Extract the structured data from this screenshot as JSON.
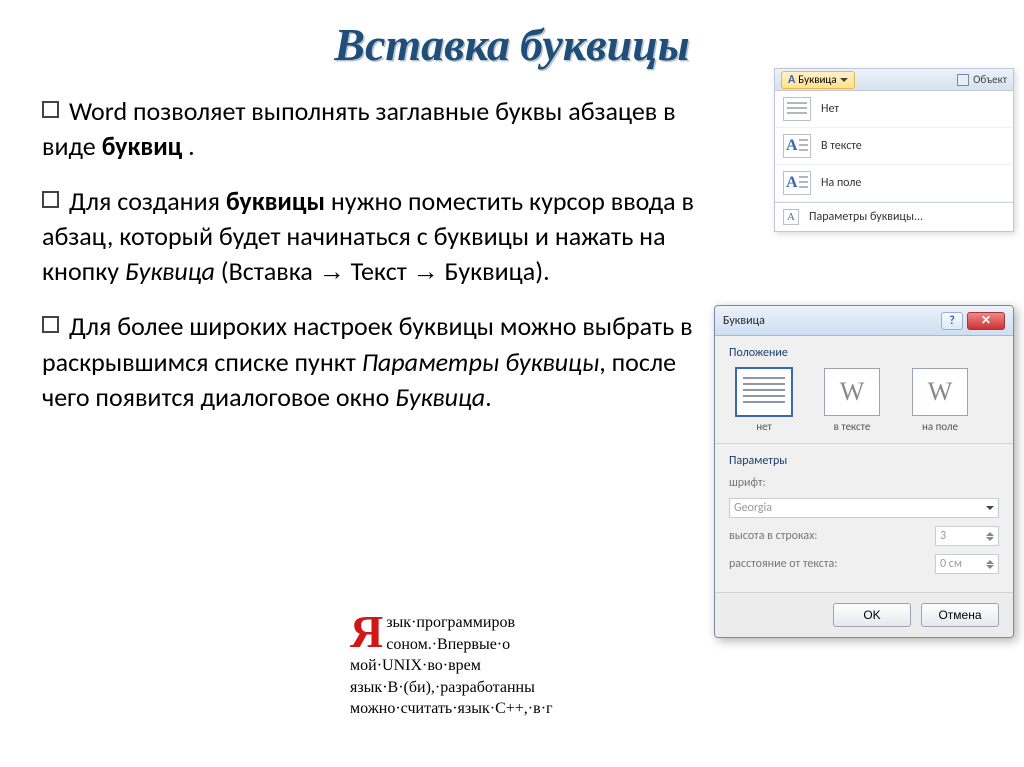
{
  "title": "Вставка буквицы",
  "bullets": {
    "b1_part1": "Word позволяет выполнять заглавные буквы абзацев в виде ",
    "b1_bold": "буквиц",
    "b1_part2": " .",
    "b2_part1": "Для создания ",
    "b2_bold": "буквицы",
    "b2_part2": " нужно поместить курсор ввода в абзац, который будет начинаться с буквицы и нажать на кнопку ",
    "b2_ital": "Буквица",
    "b2_part3": " (Вставка ",
    "b2_arrow1": "→",
    "b2_part4": " Текст ",
    "b2_arrow2": "→",
    "b2_part5": " Буквица).",
    "b3_part1": "Для более широких настроек буквицы можно выбрать в раскрывшимся списке пункт ",
    "b3_ital1": "Параметры буквицы",
    "b3_part2": ", после чего появится диалоговое окно ",
    "b3_ital2": "Буквица",
    "b3_part3": "."
  },
  "ribbon": {
    "button": "Буквица",
    "object": "Объект",
    "items": {
      "none": "Нет",
      "in_text": "В тексте",
      "in_margin": "На поле",
      "params": "Параметры буквицы..."
    }
  },
  "dialog": {
    "title": "Буквица",
    "section_position": "Положение",
    "pos_none": "нет",
    "pos_in_text": "в тексте",
    "pos_in_margin": "на поле",
    "section_params": "Параметры",
    "font_label": "шрифт:",
    "font_value": "Georgia",
    "height_label": "высота в строках:",
    "height_value": "3",
    "distance_label": "расстояние от текста:",
    "distance_value": "0 см",
    "ok": "OK",
    "cancel": "Отмена"
  },
  "example": {
    "dropcap": "Я",
    "line1": "зык·программиров",
    "line2": "соном.·Впервые·о",
    "line3": "мой·UNIX·во·врем",
    "line4": "язык·B·(би),·разработанны",
    "line5": "можно·считать·язык·С++,·в·г"
  }
}
